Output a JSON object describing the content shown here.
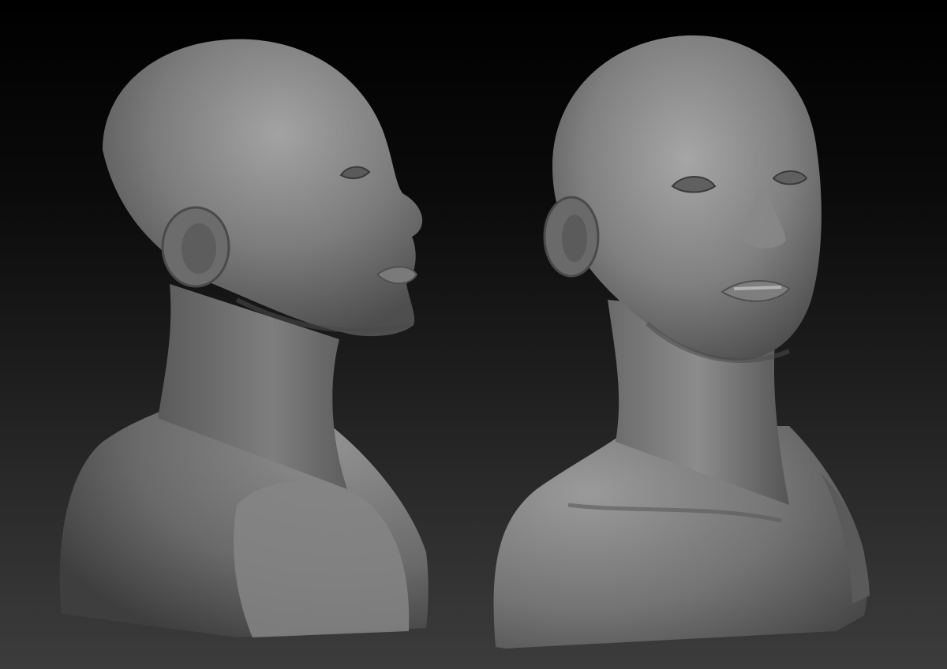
{
  "scene": {
    "subject": "sculpted-bust-render",
    "views": [
      {
        "view": "three-quarter-profile"
      },
      {
        "view": "three-quarter-front"
      }
    ],
    "colors": {
      "background_top": "#000000",
      "background_bottom": "#3c3c3c",
      "clay_light": "#9a9a9a",
      "clay_mid": "#6e6e6e",
      "clay_dark": "#3a3a3a"
    }
  }
}
